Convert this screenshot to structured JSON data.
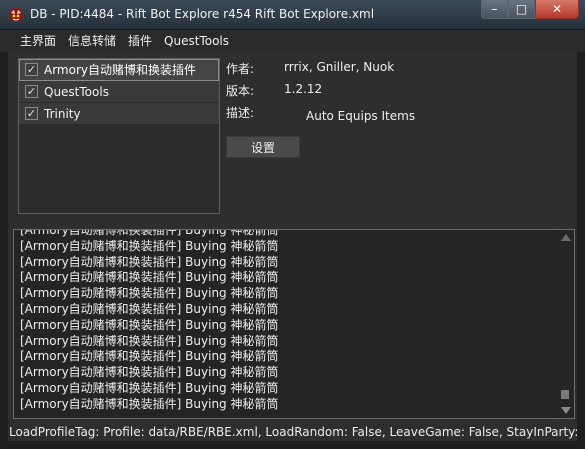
{
  "window": {
    "title": "DB - PID:4484 - Rift Bot Explore r454 Rift Bot Explore.xml",
    "controls": {
      "minimize": "–",
      "maximize": "□",
      "close": "✕"
    }
  },
  "menu": {
    "items": [
      "主界面",
      "信息转储",
      "插件",
      "QuestTools"
    ]
  },
  "plugins": [
    {
      "name": "Armory自动赌博和换装插件",
      "checked": true,
      "selected": true
    },
    {
      "name": "QuestTools",
      "checked": true,
      "selected": false
    },
    {
      "name": "Trinity",
      "checked": true,
      "selected": false
    }
  ],
  "plugin_info": {
    "author_label": "作者:",
    "author_value": "rrrix, Gniller, Nuok",
    "version_label": "版本:",
    "version_value": "1.2.12",
    "description_label": "描述:",
    "description_value": "Auto Equips Items",
    "settings_button": "设置"
  },
  "log": {
    "lines": [
      "[Armory自动赌博和换装插件] Buying 神秘箭筒",
      "[Armory自动赌博和换装插件] Buying 神秘箭筒",
      "[Armory自动赌博和换装插件] Buying 神秘箭筒",
      "[Armory自动赌博和换装插件] Buying 神秘箭筒",
      "[Armory自动赌博和换装插件] Buying 神秘箭筒",
      "[Armory自动赌博和换装插件] Buying 神秘箭筒",
      "[Armory自动赌博和换装插件] Buying 神秘箭筒",
      "[Armory自动赌博和换装插件] Buying 神秘箭筒",
      "[Armory自动赌博和换装插件] Buying 神秘箭筒",
      "[Armory自动赌博和换装插件] Buying 神秘箭筒",
      "[Armory自动赌博和换装插件] Buying 神秘箭筒",
      "[Armory自动赌博和换装插件] Buying 神秘箭筒"
    ]
  },
  "status": {
    "text": "LoadProfileTag: Profile: data/RBE/RBE.xml, LoadRandom: False, LeaveGame: False, StayInParty: False"
  },
  "colors": {
    "background": "#2e2e2e",
    "titlebar": "#2f3b47",
    "close_button": "#c24a3a"
  },
  "icons": {
    "app": "demonbuddy-app-icon",
    "checkbox": "checkmark-icon"
  }
}
